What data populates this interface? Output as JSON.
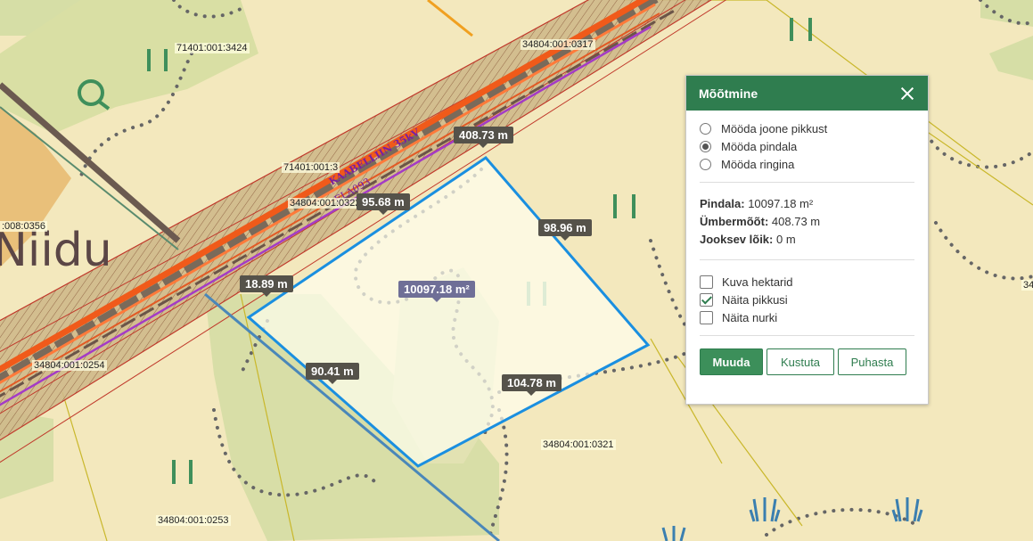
{
  "panel": {
    "title": "Mõõtmine",
    "modes": [
      {
        "label": "Mööda joone pikkust",
        "selected": false
      },
      {
        "label": "Mööda pindala",
        "selected": true
      },
      {
        "label": "Mööda ringina",
        "selected": false
      }
    ],
    "stats": {
      "area_label": "Pindala:",
      "area_value": "10097.18 m²",
      "perimeter_label": "Ümbermõõt:",
      "perimeter_value": "408.73 m",
      "segment_label": "Jooksev lõik:",
      "segment_value": "0 m"
    },
    "options": [
      {
        "label": "Kuva hektarid",
        "checked": false
      },
      {
        "label": "Näita pikkusi",
        "checked": true
      },
      {
        "label": "Näita nurki",
        "checked": false
      }
    ],
    "buttons": {
      "edit": "Muuda",
      "delete": "Kustuta",
      "clear": "Puhasta"
    }
  },
  "measurement": {
    "area": "10097.18 m²",
    "perimeter": "408.73 m",
    "segments": [
      "95.68 m",
      "98.96 m",
      "104.78 m",
      "90.41 m",
      "18.89 m"
    ]
  },
  "map": {
    "place_name": "Niidu",
    "line_labels": [
      "KAABELLIIN 35kV",
      "ELA093"
    ],
    "parcels": [
      "71401:001:3424",
      "34804:001:0317",
      "71401:001:3",
      "34804:001:0322",
      ":008:0356",
      "34804:001:0254",
      "34804:001:0321",
      "34804:001:0253",
      "34"
    ]
  },
  "colors": {
    "header": "#2f7d4f",
    "polygon_stroke": "#1a8fe0",
    "corridor": "#c0392b"
  }
}
